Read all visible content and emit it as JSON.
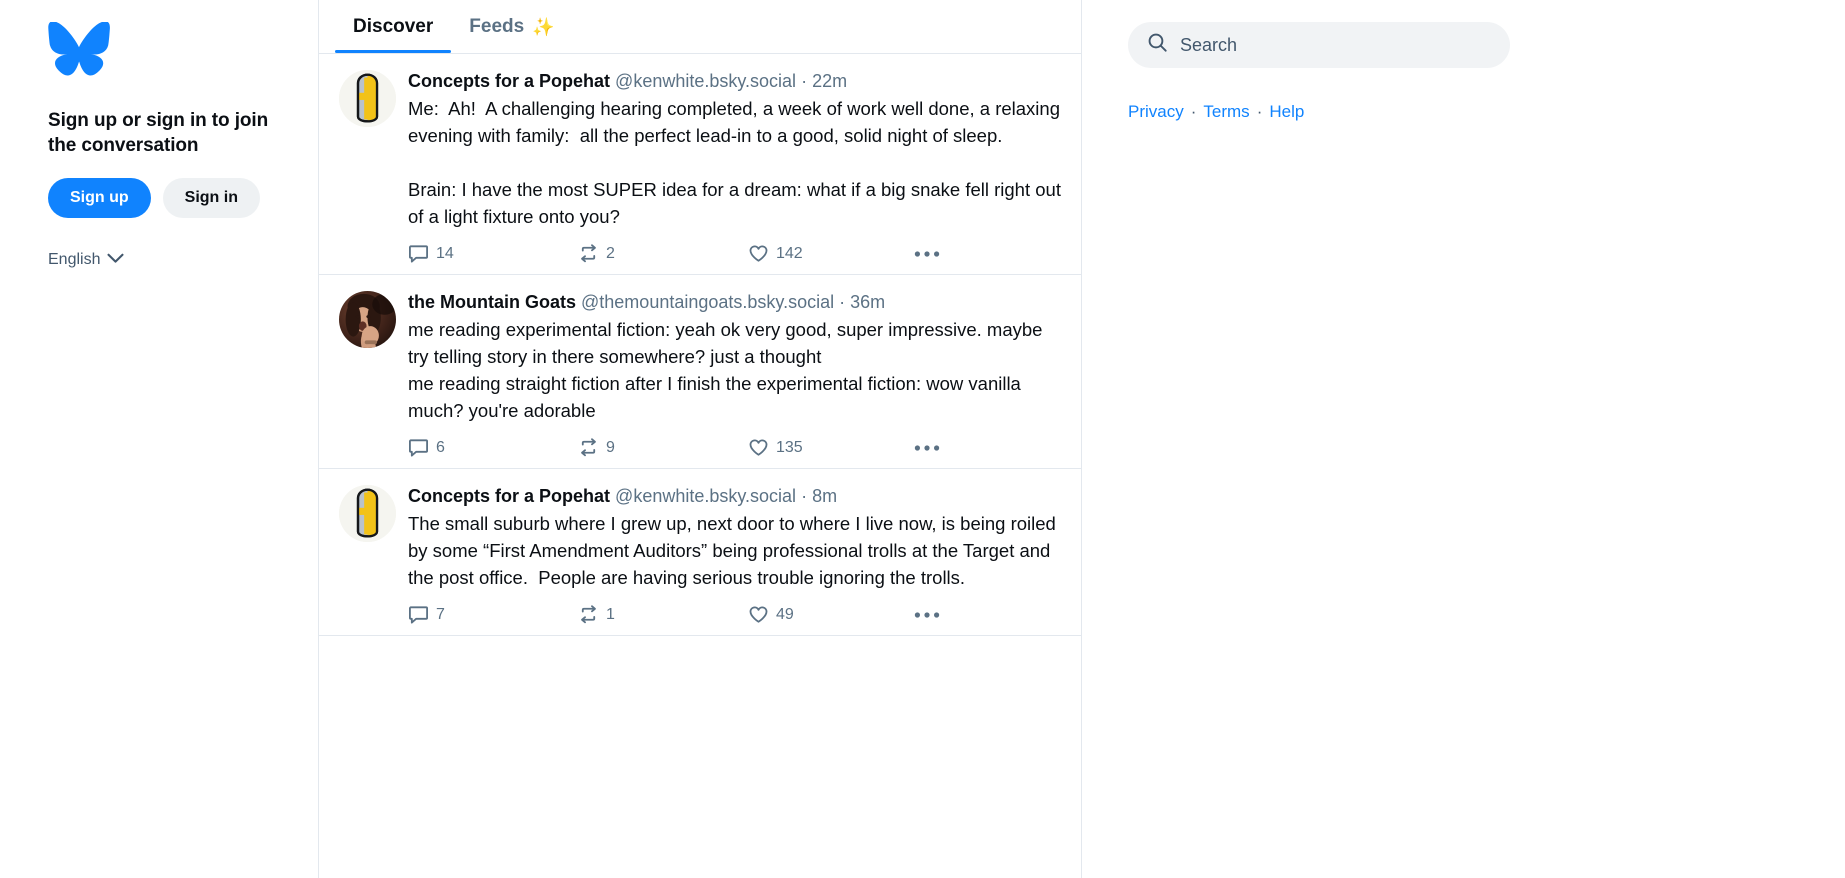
{
  "brand": {
    "logo_icon": "bluesky-butterfly-logo",
    "accent_color": "#1083fe"
  },
  "sidebar": {
    "signin_prompt": "Sign up or sign in to join the conversation",
    "signup_label": "Sign up",
    "signin_label": "Sign in",
    "language_label": "English",
    "language_chevron_icon": "chevron-down-icon"
  },
  "tabs": [
    {
      "label": "Discover",
      "emoji": "",
      "active": true
    },
    {
      "label": "Feeds",
      "emoji": "✨",
      "active": false
    }
  ],
  "posts": [
    {
      "avatar_icon": "popehat-mitre-avatar",
      "display_name": "Concepts for a Popehat",
      "handle": "@kenwhite.bsky.social",
      "separator": "·",
      "timestamp": "22m",
      "text": "Me:  Ah!  A challenging hearing completed, a week of work well done, a relaxing evening with family:  all the perfect lead-in to a good, solid night of sleep.\n\nBrain: I have the most SUPER idea for a dream: what if a big snake fell right out of a light fixture onto you?",
      "reply_icon": "reply-bubble-icon",
      "reply_count": "14",
      "repost_icon": "repost-arrows-icon",
      "repost_count": "2",
      "like_icon": "heart-icon",
      "like_count": "142",
      "more_icon": "ellipsis-icon"
    },
    {
      "avatar_icon": "mountain-goats-photo-avatar",
      "display_name": "the Mountain Goats",
      "handle": "@themountaingoats.bsky.social",
      "separator": "·",
      "timestamp": "36m",
      "text": "me reading experimental fiction: yeah ok very good, super impressive. maybe try telling story in there somewhere? just a thought\nme reading straight fiction after I finish the experimental fiction: wow vanilla much? you're adorable",
      "reply_icon": "reply-bubble-icon",
      "reply_count": "6",
      "repost_icon": "repost-arrows-icon",
      "repost_count": "9",
      "like_icon": "heart-icon",
      "like_count": "135",
      "more_icon": "ellipsis-icon"
    },
    {
      "avatar_icon": "popehat-mitre-avatar",
      "display_name": "Concepts for a Popehat",
      "handle": "@kenwhite.bsky.social",
      "separator": "·",
      "timestamp": "8m",
      "text": "The small suburb where I grew up, next door to where I live now, is being roiled by some “First Amendment Auditors” being professional trolls at the Target and the post office.  People are having serious trouble ignoring the trolls.",
      "reply_icon": "reply-bubble-icon",
      "reply_count": "7",
      "repost_icon": "repost-arrows-icon",
      "repost_count": "1",
      "like_icon": "heart-icon",
      "like_count": "49",
      "more_icon": "ellipsis-icon"
    }
  ],
  "search": {
    "icon": "search-icon",
    "placeholder": "Search",
    "value": ""
  },
  "footer": {
    "privacy_label": "Privacy",
    "sep1": "·",
    "terms_label": "Terms",
    "sep2": "·",
    "help_label": "Help"
  }
}
